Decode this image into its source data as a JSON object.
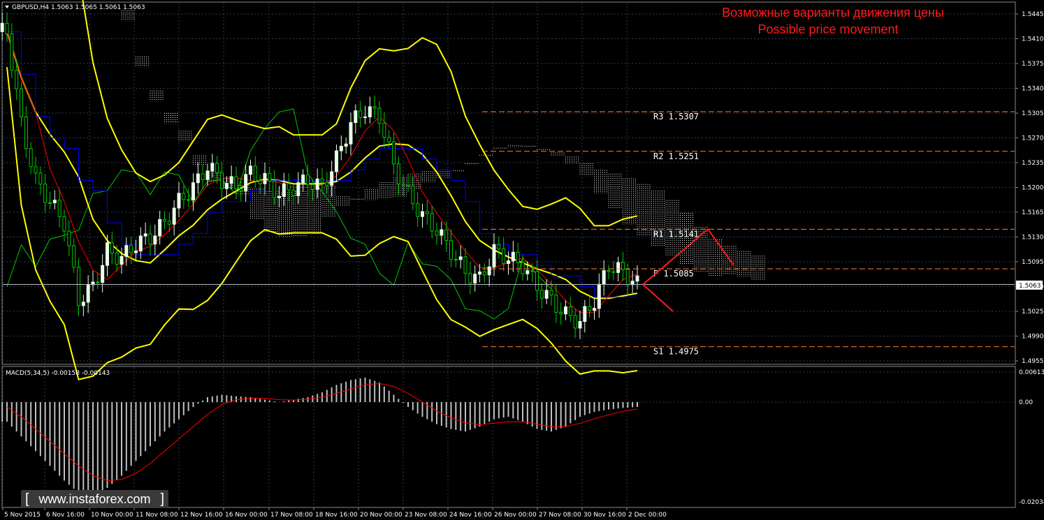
{
  "header": {
    "symbol_label": "GBPUSD,H4  1.5063 1.5065 1.5061 1.5063"
  },
  "title": {
    "line1": "Возможные варианты движения цены",
    "line2": "Possible price movement"
  },
  "macd_label": "MACD(5,34,5) -0.00158 -0.00143",
  "watermark": {
    "text": "www.instaforex.com",
    "left_bracket": "[",
    "right_bracket": "]"
  },
  "price_tag": "1.5063",
  "colors": {
    "background": "#000000",
    "grid": "#2f3d52",
    "bull": "#e8ffe8",
    "bear": "#00c800",
    "band": "#ffff00",
    "tenkan": "#ff0000",
    "kijun": "#0000ff",
    "chikou": "#00c800",
    "cloud": "#f0f0f0",
    "pivot_lines": "#ff7f2a",
    "forecast": "#ff1a1a",
    "macd_hist": "#c0c0c0",
    "macd_signal": "#ff0000",
    "title": "#ff1a1a"
  },
  "chart_data": [
    {
      "type": "candlestick",
      "symbol": "GBPUSD",
      "timeframe": "H4",
      "ylim": [
        1.4955,
        1.5445
      ],
      "y_ticks": [
        1.5445,
        1.541,
        1.5375,
        1.534,
        1.5305,
        1.527,
        1.5235,
        1.52,
        1.5165,
        1.513,
        1.5095,
        1.506,
        1.5025,
        1.499,
        1.4955
      ],
      "y_tick_labels": [
        "1.5445",
        "1.5410",
        "1.5375",
        "1.5340",
        "1.5305",
        "1.5270",
        "1.5235",
        "1.5200",
        "1.5165",
        "1.5130",
        "1.5095",
        "1.5060",
        "1.5025",
        "1.4990",
        "1.4955"
      ],
      "x_tick_labels": [
        "5 Nov 2015",
        "6 Nov 16:00",
        "10 Nov 00:00",
        "11 Nov 08:00",
        "12 Nov 16:00",
        "16 Nov 00:00",
        "17 Nov 08:00",
        "18 Nov 16:00",
        "20 Nov 00:00",
        "23 Nov 08:00",
        "24 Nov 16:00",
        "26 Nov 00:00",
        "27 Nov 08:00",
        "30 Nov 16:00",
        "2 Dec 00:00"
      ],
      "current_price": 1.5063,
      "pivot_levels": [
        {
          "name": "R3",
          "value": 1.5307,
          "label": "R3 1.5307"
        },
        {
          "name": "R2",
          "value": 1.5251,
          "label": "R2 1.5251"
        },
        {
          "name": "R1",
          "value": 1.5141,
          "label": "R1 1.5141"
        },
        {
          "name": "P",
          "value": 1.5085,
          "label": "P  1.5085"
        },
        {
          "name": "S1",
          "value": 1.4975,
          "label": "S1 1.4975"
        }
      ],
      "close_series": [
        1.542,
        1.529,
        1.521,
        1.518,
        1.515,
        1.504,
        1.506,
        1.511,
        1.51,
        1.512,
        1.513,
        1.515,
        1.518,
        1.52,
        1.523,
        1.521,
        1.52,
        1.522,
        1.521,
        1.519,
        1.52,
        1.521,
        1.52,
        1.524,
        1.529,
        1.531,
        1.53,
        1.523,
        1.519,
        1.516,
        1.514,
        1.511,
        1.508,
        1.507,
        1.511,
        1.51,
        1.509,
        1.506,
        1.504,
        1.502,
        1.501,
        1.504,
        1.509,
        1.508,
        1.5063
      ],
      "forecast_paths": [
        {
          "name": "up",
          "points": [
            [
              1.5063
            ],
            [
              1.5141
            ],
            [
              1.509
            ]
          ]
        },
        {
          "name": "down",
          "points": [
            [
              1.5063
            ],
            [
              1.5025
            ]
          ]
        }
      ]
    },
    {
      "type": "bar",
      "name": "MACD(5,34,5)",
      "ylim": [
        -0.02034,
        0.00613
      ],
      "y_tick_labels": [
        "0.00613",
        "0.00",
        "-0.02034"
      ],
      "values": [
        -0.004,
        -0.007,
        -0.01,
        -0.013,
        -0.016,
        -0.0185,
        -0.019,
        -0.0175,
        -0.015,
        -0.012,
        -0.009,
        -0.006,
        -0.0035,
        -0.001,
        0.001,
        0.0015,
        0.0012,
        0.001,
        0.0005,
        0.0,
        0.0005,
        0.001,
        0.002,
        0.0035,
        0.0045,
        0.005,
        0.004,
        0.0015,
        -0.001,
        -0.003,
        -0.0045,
        -0.0055,
        -0.006,
        -0.005,
        -0.0035,
        -0.003,
        -0.004,
        -0.0055,
        -0.006,
        -0.005,
        -0.003,
        -0.002,
        -0.0015,
        -0.0012,
        -0.001
      ],
      "signal": [
        -0.001,
        -0.003,
        -0.0055,
        -0.008,
        -0.0105,
        -0.013,
        -0.015,
        -0.016,
        -0.0158,
        -0.0145,
        -0.0125,
        -0.01,
        -0.0075,
        -0.005,
        -0.0025,
        -0.0005,
        0.0005,
        0.0008,
        0.0008,
        0.0005,
        0.0004,
        0.0006,
        0.001,
        0.0018,
        0.0027,
        0.0035,
        0.0038,
        0.0032,
        0.0018,
        0.0,
        -0.0018,
        -0.0032,
        -0.0042,
        -0.0046,
        -0.0043,
        -0.004,
        -0.004,
        -0.0045,
        -0.005,
        -0.005,
        -0.0043,
        -0.0034,
        -0.0026,
        -0.0019,
        -0.0014
      ]
    }
  ]
}
